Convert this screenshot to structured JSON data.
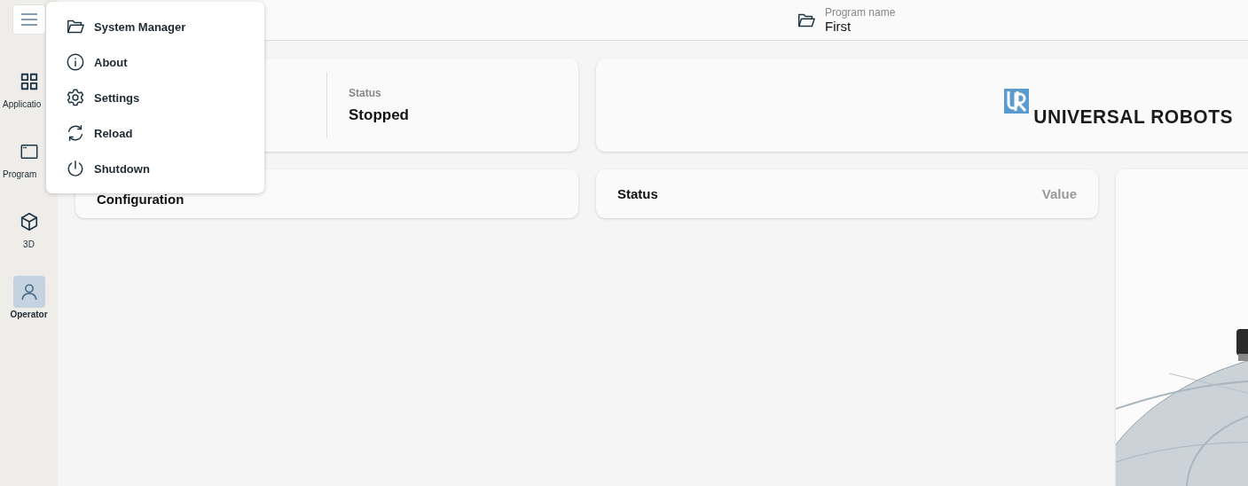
{
  "sidebar": {
    "menu_button": {
      "expanded": true
    },
    "items": [
      {
        "label": "Applicatio",
        "selected": false
      },
      {
        "label": "Program",
        "selected": false
      },
      {
        "label": "3D",
        "selected": false
      },
      {
        "label": "Operator",
        "selected": true
      }
    ]
  },
  "header": {
    "label": "Program name",
    "value": "First"
  },
  "menu": [
    {
      "label": "System Manager"
    },
    {
      "label": "About"
    },
    {
      "label": "Settings"
    },
    {
      "label": "Reload"
    },
    {
      "label": "Shutdown"
    }
  ],
  "status_card": {
    "label": "Status",
    "value": "Stopped"
  },
  "logo": {
    "text": "UNIVERSAL ROBOTS"
  },
  "configuration": {
    "title": "Configuration"
  },
  "status_table": {
    "columns": [
      "Status",
      "Value"
    ]
  }
}
